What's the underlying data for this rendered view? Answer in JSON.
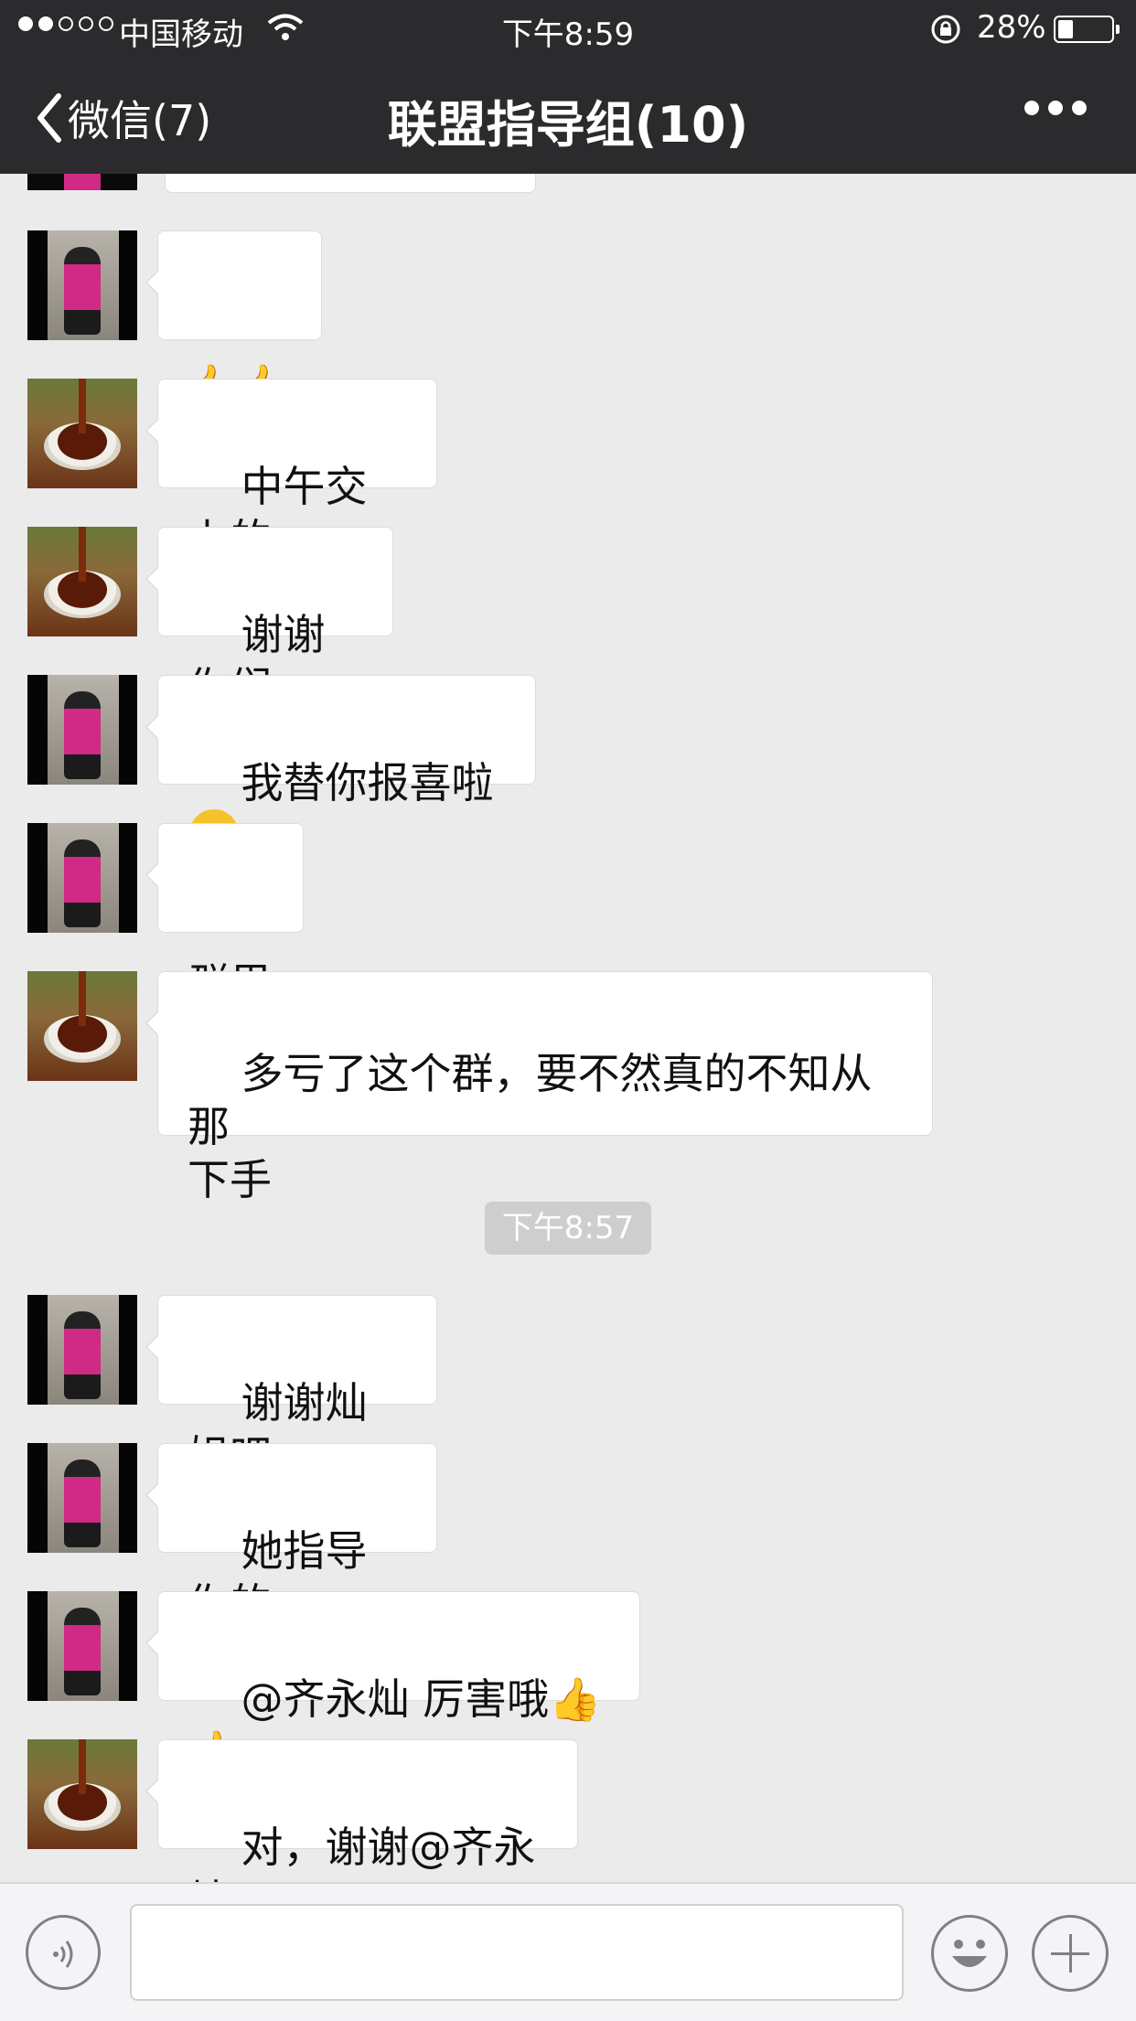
{
  "status_bar": {
    "carrier": "中国移动",
    "time": "下午8:59",
    "battery_percent": "28%",
    "battery_level": 0.28,
    "signal_strength": 2,
    "signal_max": 5
  },
  "nav": {
    "back_label": "微信(7)",
    "title": "联盟指导组(10)"
  },
  "messages": [
    {
      "avatar": "lady-in-pink",
      "text": "👍👍"
    },
    {
      "avatar": "tea-bowl",
      "text": "中午交上的"
    },
    {
      "avatar": "tea-bowl",
      "text": "谢谢你们"
    },
    {
      "avatar": "lady-in-pink",
      "text": "我替你报喜啦",
      "emoji": "blushing-smile"
    },
    {
      "avatar": "lady-in-pink",
      "text": "群里"
    },
    {
      "avatar": "tea-bowl",
      "text": "多亏了这个群，要不然真的不知从那\n下手"
    },
    {
      "avatar": "lady-in-pink",
      "text": "谢谢灿姐吧"
    },
    {
      "avatar": "lady-in-pink",
      "text": "她指导你的"
    },
    {
      "avatar": "lady-in-pink",
      "text": "@齐永灿 厉害哦👍👍"
    },
    {
      "avatar": "tea-bowl",
      "text": "对，谢谢@齐永灿"
    }
  ],
  "timestamp_divider": "下午8:57",
  "input_bar": {
    "value": "",
    "icons": [
      "voice-icon",
      "emoji-icon",
      "plus-icon"
    ]
  },
  "colors": {
    "nav_background": "#2b2b2e",
    "chat_background": "#ebebeb",
    "bubble_background": "#ffffff",
    "accent_pink": "#d02a86"
  }
}
